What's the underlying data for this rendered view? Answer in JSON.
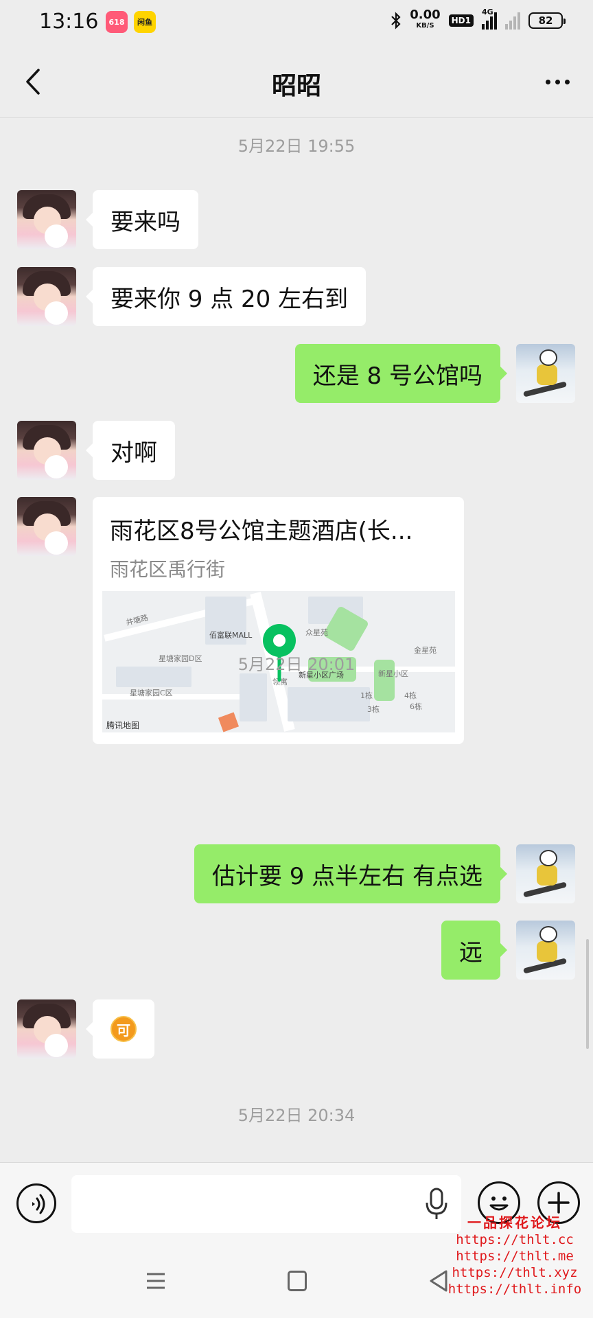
{
  "status_bar": {
    "time": "13:16",
    "app_icon_1": "618",
    "app_icon_2": "闲鱼",
    "net_speed": "0.00",
    "net_unit": "KB/S",
    "hd": "HD1",
    "network": "4G",
    "battery": "82"
  },
  "header": {
    "title": "昭昭",
    "back_icon": "chevron-left-icon",
    "more_icon": "more-dots-icon"
  },
  "messages": [
    {
      "type": "timestamp",
      "text": "5月22日 19:55"
    },
    {
      "type": "text",
      "from": "contact",
      "text": "要来吗"
    },
    {
      "type": "text",
      "from": "contact",
      "text": "要来你 9 点 20 左右到"
    },
    {
      "type": "text",
      "from": "me",
      "text": "还是 8 号公馆吗"
    },
    {
      "type": "text",
      "from": "contact",
      "text": "对啊"
    },
    {
      "type": "location",
      "from": "contact",
      "name": "雨花区8号公馆主题酒店(长...",
      "address": "雨花区禹行街"
    },
    {
      "type": "timestamp",
      "text": "5月22日 20:01"
    },
    {
      "type": "text",
      "from": "me",
      "text": "估计要 9 点半左右  有点选"
    },
    {
      "type": "text",
      "from": "me",
      "text": "远"
    },
    {
      "type": "sticker",
      "from": "contact",
      "text": "可"
    },
    {
      "type": "timestamp",
      "text": "5月22日 20:34"
    }
  ],
  "map": {
    "labels": {
      "road_jingtang": "井塘路",
      "mall": "佰富联MALL",
      "community_d": "星塘家园D区",
      "community_c": "星塘家园C区",
      "zhongxing": "众星苑",
      "jinxing": "金星苑",
      "plaza": "新星小区广场",
      "xinxing": "新星小区",
      "lingyu": "领寓",
      "building_1": "1栋",
      "building_4": "4栋",
      "building_3": "3栋",
      "building_6": "6栋"
    },
    "credit": "腾讯地图",
    "pin_color": "#07c160"
  },
  "input_bar": {
    "placeholder": "",
    "voice_icon": "voice-icon",
    "mic_icon": "mic-icon",
    "emoji_icon": "emoji-icon",
    "plus_icon": "plus-icon"
  },
  "watermark": {
    "title": "一品探花论坛",
    "urls": [
      "https://thlt.cc",
      "https://thlt.me",
      "https://thlt.xyz",
      "https://thlt.info"
    ]
  },
  "colors": {
    "background": "#ededed",
    "outgoing_bubble": "#95ec69",
    "incoming_bubble": "#ffffff",
    "timestamp": "#9d9d9d"
  }
}
